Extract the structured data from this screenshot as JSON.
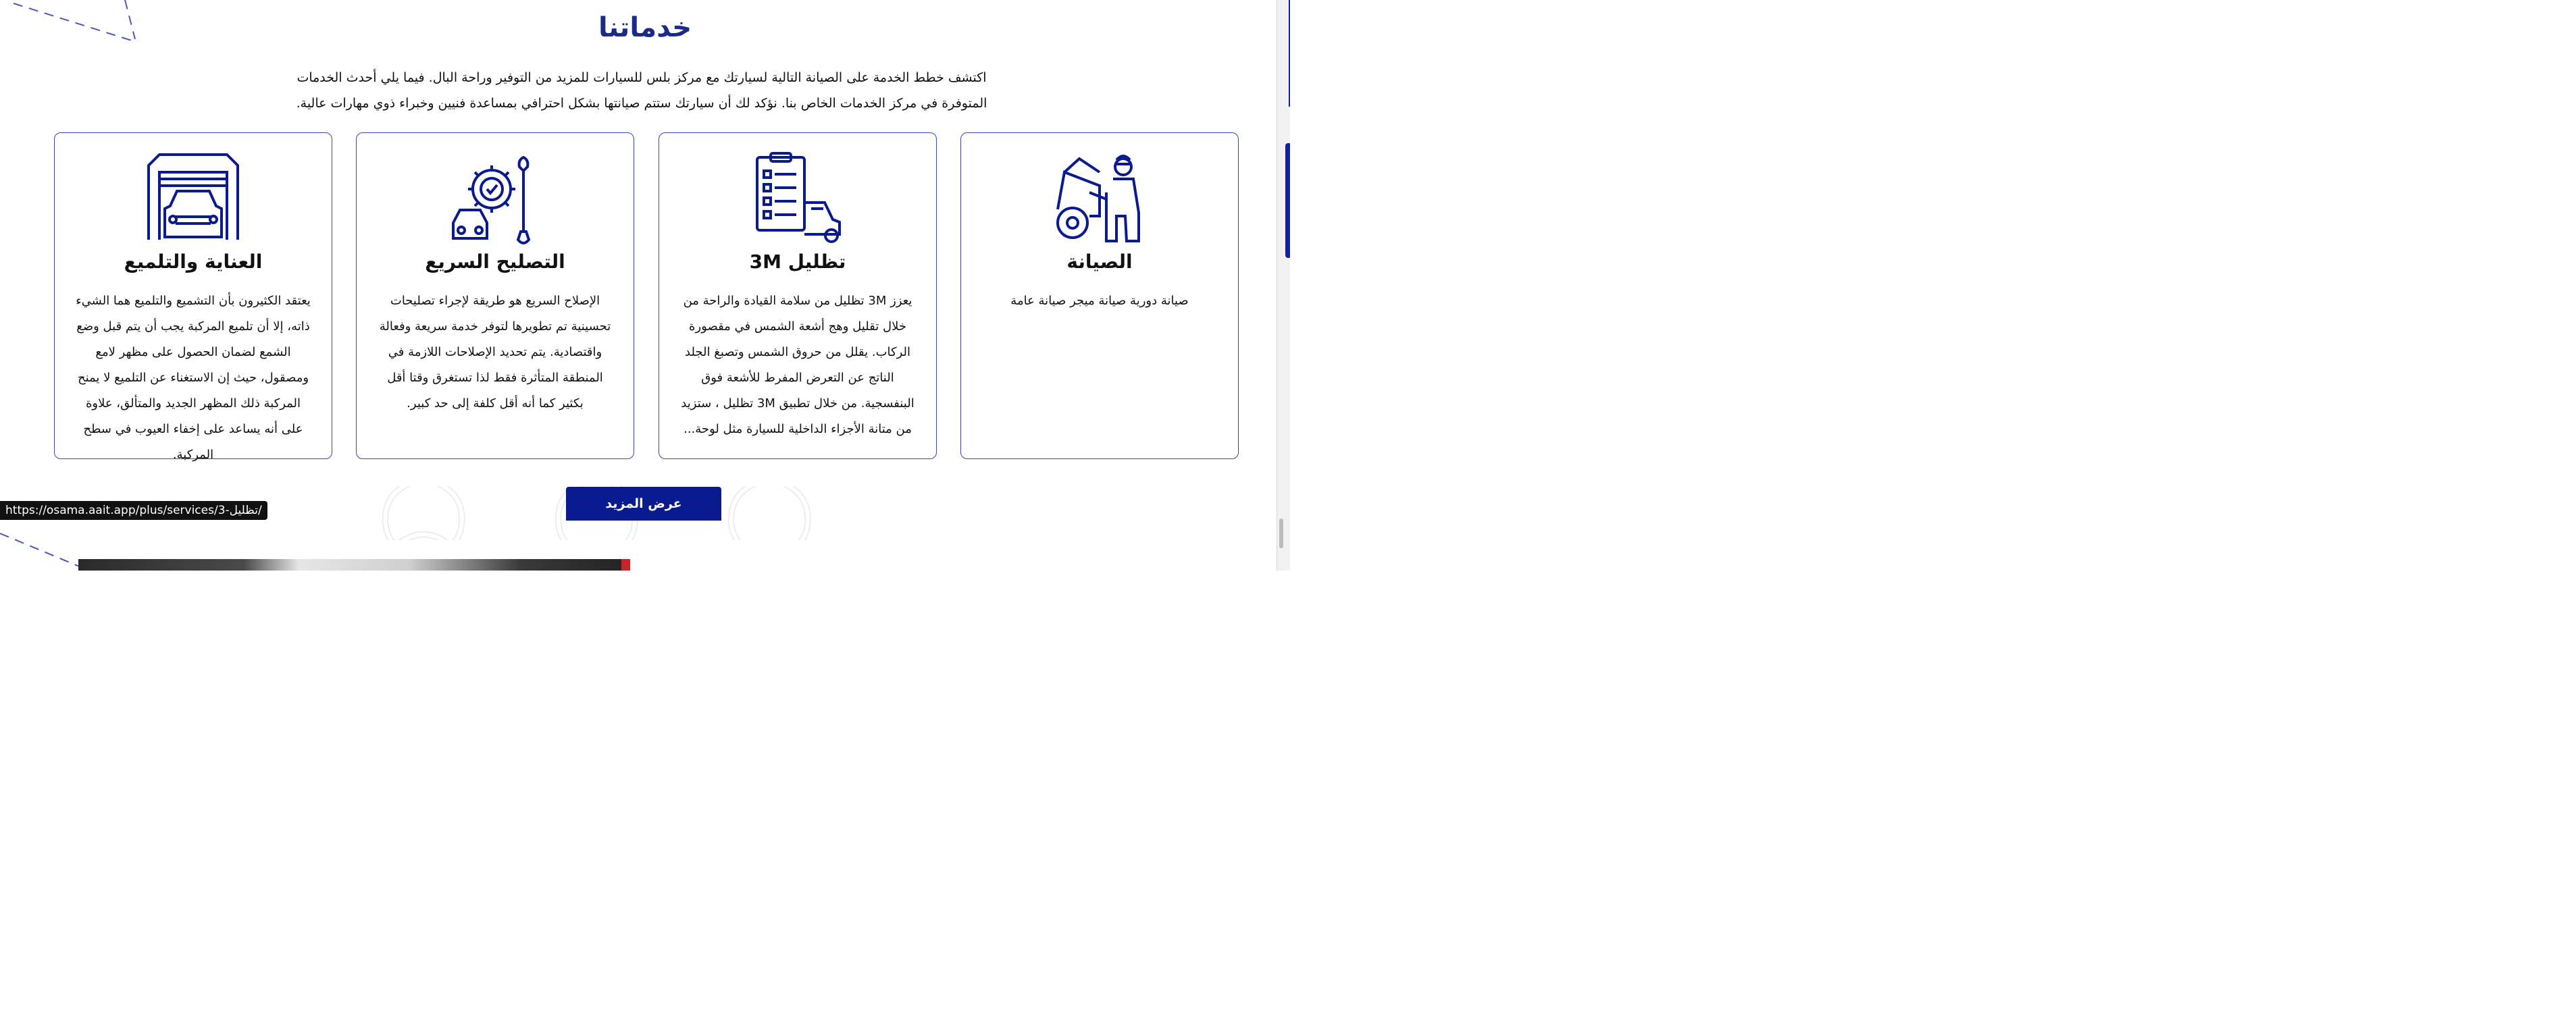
{
  "section": {
    "title": "خدماتنا",
    "intro_line1": "اكتشف خطط الخدمة على الصيانة التالية لسيارتك مع مركز بلس للسيارات للمزيد من التوفير وراحة البال. فيما يلي أحدث الخدمات",
    "intro_line2": "المتوفرة في مركز الخدمات الخاص بنا. نؤكد لك أن سيارتك ستتم صيانتها بشكل احترافي بمساعدة فنيين وخبراء ذوي مهارات عالية."
  },
  "cards": [
    {
      "title": "الصيانة",
      "icon": "mechanic-car-icon",
      "body": "صيانة دورية صيانة ميجر صيانة عامة"
    },
    {
      "title": "تظليل 3M",
      "icon": "checklist-car-icon",
      "body": "يعزز 3M تظليل من سلامة القيادة والراحة من خلال تقليل وهج أشعة الشمس في مقصورة الركاب. يقلل من حروق الشمس وتصبغ الجلد الناتج عن التعرض المفرط للأشعة فوق البنفسجية. من خلال تطبيق 3M تظليل ، ستزيد من متانة الأجزاء الداخلية للسيارة مثل لوحة..."
    },
    {
      "title": "التصليح السريع",
      "icon": "gear-wrench-car-icon",
      "body": "الإصلاح السريع هو طريقة لإجراء تصليحات تحسينية تم تطويرها لتوفر خدمة سريعة وفعالة واقتصادية. يتم تحديد الإصلاحات اللازمة في المنطقة المتأثرة فقط لذا تستغرق وقتا أقل بكثير كما أنه أقل كلفة إلى حد كبير."
    },
    {
      "title": "العناية والتلميع",
      "icon": "garage-car-icon",
      "body": "يعتقد الكثيرون بأن التشميع والتلميع هما الشيء ذاته، إلا أن تلميع المركبة يجب أن يتم قبل وضع الشمع لضمان الحصول على مظهر لامع ومصقول، حيث إن الاستغناء عن التلميع لا يمنح المركبة ذلك المظهر الجديد والمتألق، علاوة على أنه يساعد على إخفاء العيوب في سطح المركبة."
    }
  ],
  "more_button": "عرض المزيد",
  "status_url": "https://osama.aait.app/plus/services/3-تظليل/",
  "colors": {
    "primary": "#0a1a8f",
    "card_border": "#3a47b4",
    "title": "#1a2a8c"
  }
}
